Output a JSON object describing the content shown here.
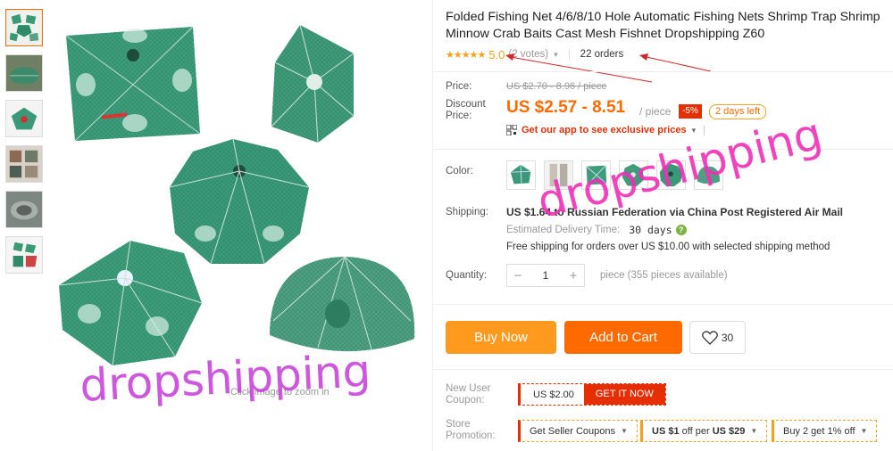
{
  "product": {
    "title": "Folded Fishing Net 4/6/8/10 Hole Automatic Fishing Nets Shrimp Trap Shrimp Minnow Crab Baits Cast Mesh Fishnet Dropshipping Z60",
    "stars": "★★★★★",
    "rating": "5.0",
    "votes": "(2 votes)",
    "orders": "22 orders"
  },
  "gallery": {
    "thumbnail_count": 6,
    "zoom_hint": "Click image to zoom in"
  },
  "watermark": {
    "left_text": "dropshipping",
    "right_text": "dropshipping"
  },
  "pricing": {
    "price_label": "Price:",
    "original_price": "US $2.70 - 8.96 / piece",
    "discount_label": "Discount Price:",
    "discount_price": "US $2.57 - 8.51",
    "per_piece": "/ piece",
    "discount_percent": "-5%",
    "days_left": "2 days left",
    "app_prices": "Get our app to see exclusive prices"
  },
  "options": {
    "color_label": "Color:",
    "color_swatch_count": 6
  },
  "shipping": {
    "label": "Shipping:",
    "main": "US $1.64 to Russian Federation via China Post Registered Air Mail",
    "estimated_label": "Estimated Delivery Time:",
    "estimated_days": "30 days",
    "free_shipping": "Free shipping for orders over US $10.00 with selected shipping method"
  },
  "quantity": {
    "label": "Quantity:",
    "value": "1",
    "minus": "−",
    "plus": "+",
    "available": "piece (355 pieces available)"
  },
  "actions": {
    "buy_now": "Buy Now",
    "add_to_cart": "Add to Cart",
    "wishlist_count": "30"
  },
  "coupons": {
    "new_user_label": "New User Coupon:",
    "new_user_amount": "US $2.00",
    "get_it_now": "GET IT NOW",
    "store_promo_label": "Store Promotion:",
    "seller_coupons": "Get Seller Coupons",
    "promo2_a": "US $1",
    "promo2_b": " off per ",
    "promo2_c": "US $29",
    "promo3": "Buy 2 get 1% off"
  },
  "colors": {
    "accent": "#ff6a00",
    "buy_now": "#ff9a1f",
    "discount_red": "#e62e04",
    "star": "#f4a11c",
    "net_green": "#2e8b6a",
    "watermark": "#c53bd8"
  }
}
